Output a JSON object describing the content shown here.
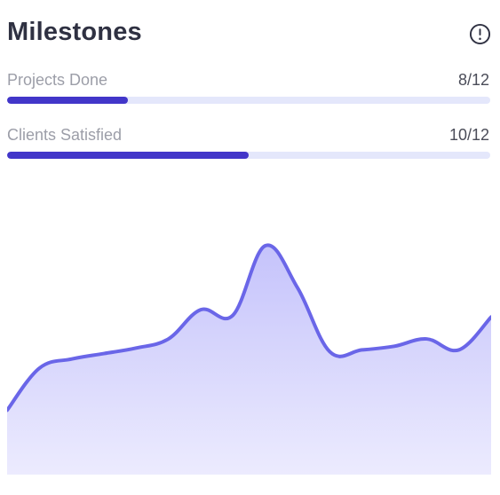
{
  "card": {
    "title": "Milestones",
    "info_icon": "info-circle-icon"
  },
  "stats": [
    {
      "label": "Projects Done",
      "value_text": "8/12",
      "progress_percent": 25
    },
    {
      "label": "Clients Satisfied",
      "value_text": "10/12",
      "progress_percent": 50
    }
  ],
  "colors": {
    "title": "#2f3142",
    "label": "#9c9ea8",
    "bar_fill": "#4236c9",
    "bar_track": "#e4e7fb",
    "line": "#6a66e8",
    "area_top": "#c5c3fb",
    "area_bottom": "#ecebfe"
  },
  "chart_data": {
    "type": "area",
    "x": [
      0,
      1,
      2,
      3,
      4,
      5,
      6,
      7,
      8,
      9,
      10,
      11,
      12,
      13,
      14,
      15,
      16,
      17,
      18,
      19,
      20,
      21,
      22,
      23
    ],
    "series": [
      {
        "values": [
          10,
          33,
          38,
          41,
          44,
          49,
          65,
          62,
          100,
          77,
          42,
          43,
          45,
          49,
          43,
          61
        ]
      }
    ],
    "xlabel": "",
    "ylabel": "",
    "grid": false,
    "legend": "none"
  }
}
